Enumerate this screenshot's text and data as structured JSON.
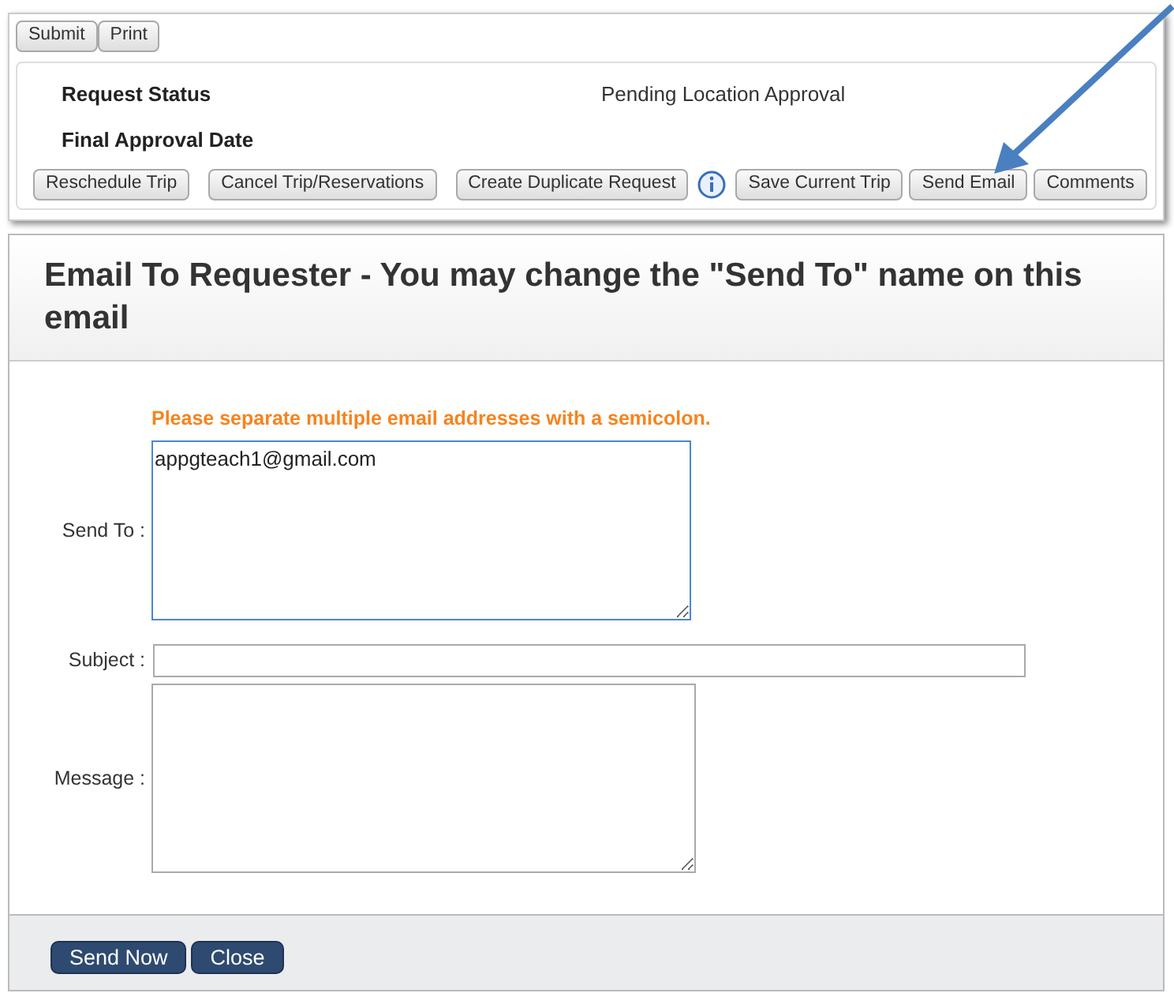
{
  "toolbar": {
    "buttons": [
      "Submit",
      "Print"
    ]
  },
  "request": {
    "fields": [
      {
        "label": "Request Status",
        "value": "Pending Location Approval"
      },
      {
        "label": "Final Approval Date"
      }
    ],
    "actions": [
      {
        "kind": "button",
        "label": "Reschedule Trip"
      },
      {
        "kind": "button",
        "label": "Cancel Trip/Reservations"
      },
      {
        "kind": "button",
        "label": "Create Duplicate Request"
      },
      {
        "kind": "info"
      },
      {
        "kind": "button",
        "label": "Save Current Trip"
      },
      {
        "kind": "button",
        "label": "Send Email"
      },
      {
        "kind": "button",
        "label": "Comments"
      }
    ]
  },
  "dialog": {
    "title": "Email To Requester - You may change the \"Send To\" name on this email",
    "hint": "Please separate multiple email addresses with a semicolon.",
    "send_to": {
      "label": "Send To :",
      "value": "appgteach1@gmail.com"
    },
    "subject": {
      "label": "Subject :"
    },
    "message": {
      "label": "Message :"
    },
    "buttons": [
      "Send Now",
      "Close"
    ]
  }
}
